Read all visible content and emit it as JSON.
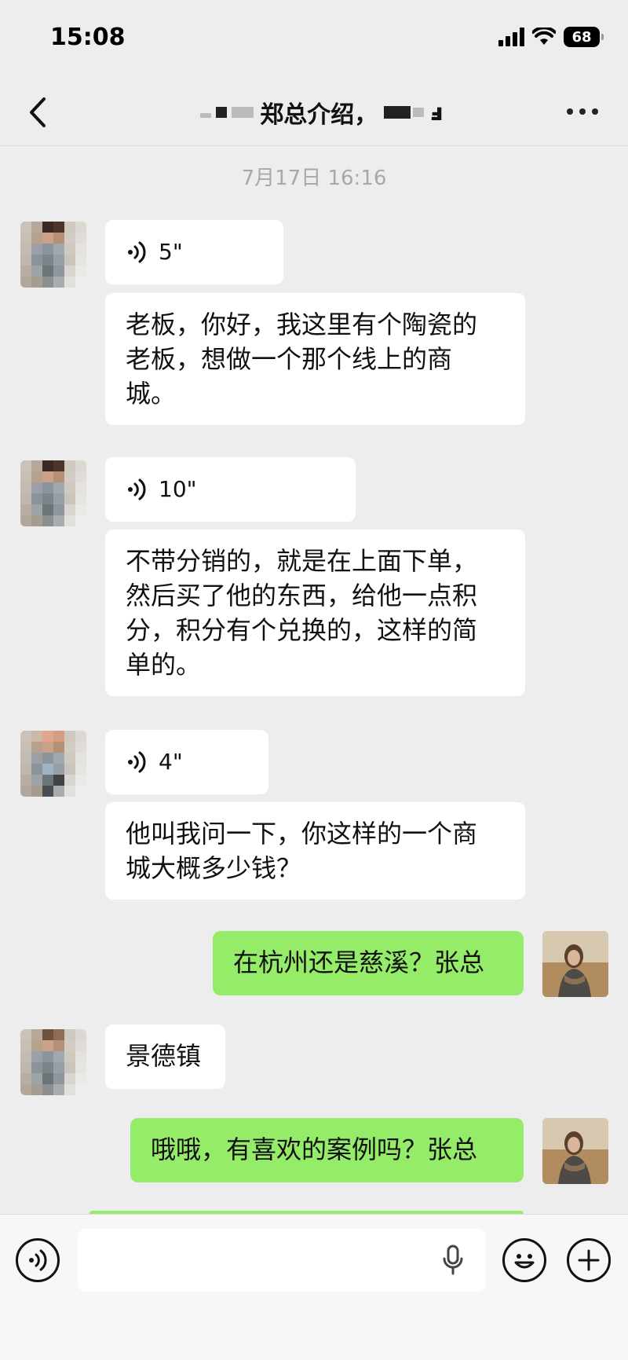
{
  "status_bar": {
    "time": "15:08",
    "battery": "68",
    "icons": [
      "cellular-signal-icon",
      "wifi-icon",
      "battery-icon"
    ]
  },
  "nav": {
    "title_visible": "郑总介绍，",
    "title_trailing": "ⅎ",
    "back_icon": "chevron-left-icon",
    "more_icon": "more-dots-icon"
  },
  "timestamp": "7月17日 16:16",
  "messages": [
    {
      "sender": "other",
      "type": "voice",
      "duration": "5\""
    },
    {
      "sender": "other",
      "type": "text",
      "lines": [
        "老板，你好，我这里有个陶瓷的",
        "老板，想做一个那个线上的商",
        "城。"
      ]
    },
    {
      "sender": "other",
      "type": "voice",
      "duration": "10\""
    },
    {
      "sender": "other",
      "type": "text",
      "lines": [
        "不带分销的，就是在上面下单，",
        "然后买了他的东西，给他一点积",
        "分，积分有个兑换的，这样的简",
        "单的。"
      ]
    },
    {
      "sender": "other",
      "type": "voice",
      "duration": "4\""
    },
    {
      "sender": "other",
      "type": "text",
      "lines": [
        "他叫我问一下，你这样的一个商",
        "城大概多少钱？"
      ]
    },
    {
      "sender": "me",
      "type": "text",
      "lines": [
        "在杭州还是慈溪？张总"
      ]
    },
    {
      "sender": "other",
      "type": "text",
      "lines": [
        "景德镇"
      ]
    },
    {
      "sender": "me",
      "type": "text",
      "lines": [
        "哦哦，有喜欢的案例吗？张总"
      ]
    }
  ],
  "colors": {
    "background": "#ededed",
    "bubble_other": "#ffffff",
    "bubble_me": "#95ec69",
    "timestamp": "#a8a8a8"
  },
  "bottom_bar": {
    "icons": [
      "voice-mode-icon",
      "microphone-icon",
      "emoji-icon",
      "plus-icon"
    ]
  }
}
